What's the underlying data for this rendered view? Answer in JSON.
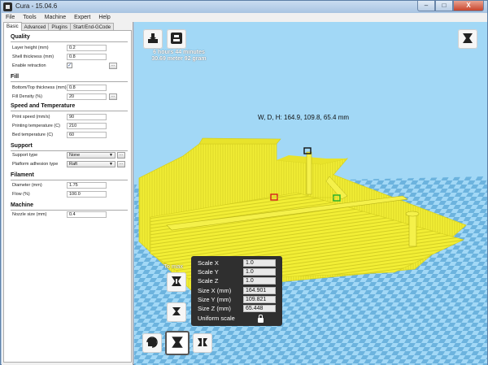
{
  "window": {
    "title": "Cura - 15.04.6",
    "buttons": [
      "–",
      "□",
      "X"
    ]
  },
  "menu": [
    "File",
    "Tools",
    "Machine",
    "Expert",
    "Help"
  ],
  "tabs": [
    "Basic",
    "Advanced",
    "Plugins",
    "Start/End-GCode"
  ],
  "sections": {
    "quality": "Quality",
    "fill": "Fill",
    "speed": "Speed and Temperature",
    "support": "Support",
    "filament": "Filament",
    "machine": "Machine"
  },
  "fields": {
    "layer_height": {
      "label": "Layer height (mm)",
      "value": "0.2"
    },
    "shell_thickness": {
      "label": "Shell thickness (mm)",
      "value": "0.8"
    },
    "enable_retraction": {
      "label": "Enable retraction",
      "checked": "✓"
    },
    "bottom_top": {
      "label": "Bottom/Top thickness (mm)",
      "value": "0.8"
    },
    "fill_density": {
      "label": "Fill Density (%)",
      "value": "20"
    },
    "print_speed": {
      "label": "Print speed (mm/s)",
      "value": "90"
    },
    "print_temp": {
      "label": "Printing temperature (C)",
      "value": "210"
    },
    "bed_temp": {
      "label": "Bed temperature (C)",
      "value": "60"
    },
    "support_type": {
      "label": "Support type",
      "value": "None"
    },
    "adhesion": {
      "label": "Platform adhesion type",
      "value": "Raft"
    },
    "diameter": {
      "label": "Diameter (mm)",
      "value": "1.75"
    },
    "flow": {
      "label": "Flow (%)",
      "value": "100.0"
    },
    "nozzle": {
      "label": "Nozzle size (mm)",
      "value": "0.4"
    }
  },
  "dots_label": "...",
  "viewport": {
    "stats_time": "6 hours 44 minutes",
    "stats_material": "30.69 meter 92 gram",
    "dimensions": "W, D, H: 164.9, 109.8, 65.4 mm",
    "to_max": "To max",
    "scale": {
      "scale_x_label": "Scale X",
      "scale_x": "1.0",
      "scale_y_label": "Scale Y",
      "scale_y": "1.0",
      "scale_z_label": "Scale Z",
      "scale_z": "1.0",
      "size_x_label": "Size X (mm)",
      "size_x": "164.901",
      "size_y_label": "Size Y (mm)",
      "size_y": "109.821",
      "size_z_label": "Size Z (mm)",
      "size_z": "65.448",
      "uniform_label": "Uniform scale"
    }
  },
  "colors": {
    "model": "#f2ee35",
    "bed_light": "#a2d8f6",
    "bed_dark": "#6cb3de",
    "panel_bg": "#2f2f2f"
  }
}
